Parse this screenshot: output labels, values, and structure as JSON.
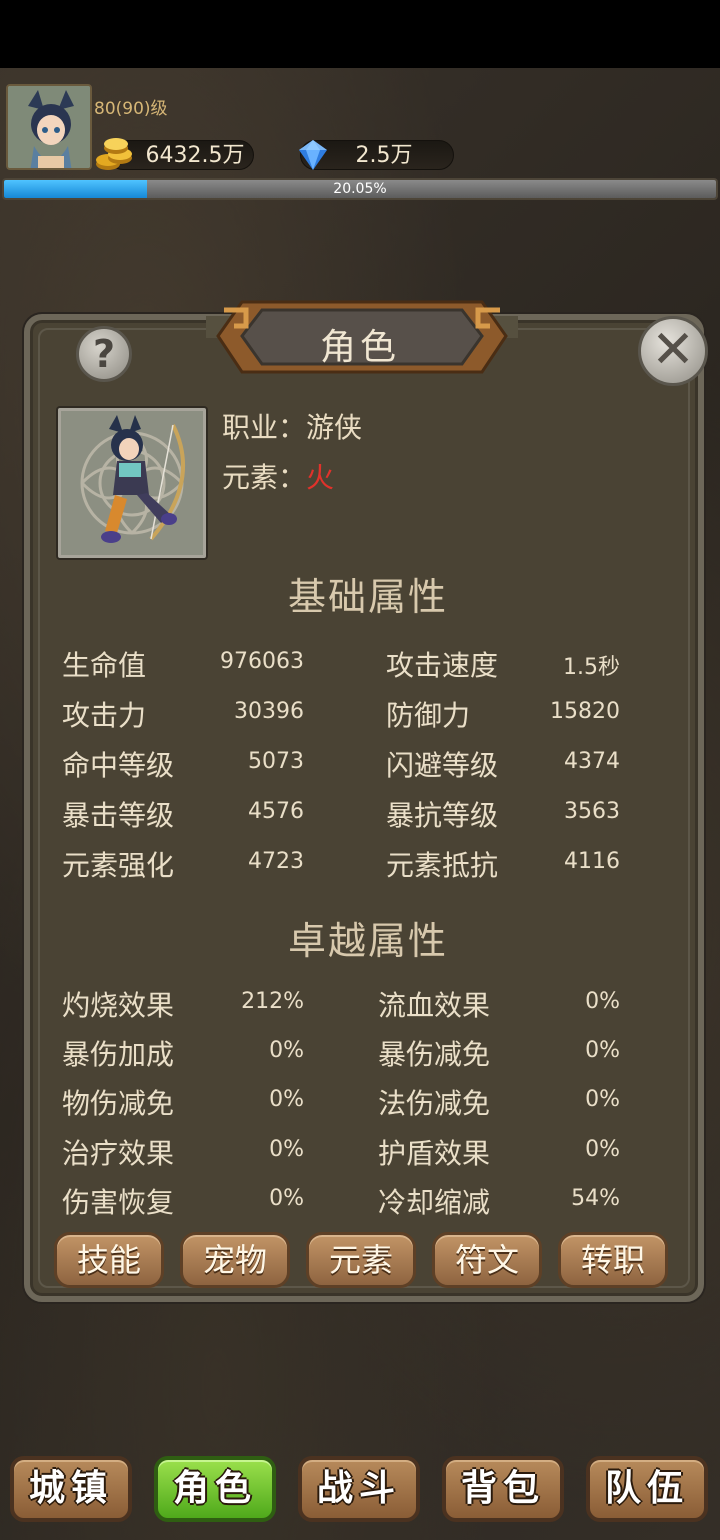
{
  "header": {
    "level": "80(90)级",
    "gold": "6432.5万",
    "gems": "2.5万",
    "xp_percent_text": "20.05%",
    "xp_fraction": 0.2005
  },
  "panel": {
    "title": "角色",
    "job_label": "职业：",
    "job_value": "游侠",
    "element_label": "元素：",
    "element_value": "火",
    "basic_title": "基础属性",
    "advanced_title": "卓越属性",
    "basic_stats": [
      {
        "label": "生命值",
        "value": "976063"
      },
      {
        "label": "攻击速度",
        "value": "1.5秒"
      },
      {
        "label": "攻击力",
        "value": "30396"
      },
      {
        "label": "防御力",
        "value": "15820"
      },
      {
        "label": "命中等级",
        "value": "5073"
      },
      {
        "label": "闪避等级",
        "value": "4374"
      },
      {
        "label": "暴击等级",
        "value": "4576"
      },
      {
        "label": "暴抗等级",
        "value": "3563"
      },
      {
        "label": "元素强化",
        "value": "4723"
      },
      {
        "label": "元素抵抗",
        "value": "4116"
      }
    ],
    "advanced_stats": [
      {
        "label": "灼烧效果",
        "value": "212%"
      },
      {
        "label": "流血效果",
        "value": "0%"
      },
      {
        "label": "暴伤加成",
        "value": "0%"
      },
      {
        "label": "暴伤减免",
        "value": "0%"
      },
      {
        "label": "物伤减免",
        "value": "0%"
      },
      {
        "label": "法伤减免",
        "value": "0%"
      },
      {
        "label": "治疗效果",
        "value": "0%"
      },
      {
        "label": "护盾效果",
        "value": "0%"
      },
      {
        "label": "伤害恢复",
        "value": "0%"
      },
      {
        "label": "冷却缩减",
        "value": "54%"
      }
    ],
    "sub_buttons": [
      "技能",
      "宠物",
      "元素",
      "符文",
      "转职"
    ]
  },
  "nav": {
    "items": [
      "城镇",
      "角色",
      "战斗",
      "背包",
      "队伍"
    ],
    "active": "角色"
  },
  "colors": {
    "fire": "#e0322b",
    "xp_fill": "#1688d6",
    "nav_active": "#4fa91b"
  }
}
